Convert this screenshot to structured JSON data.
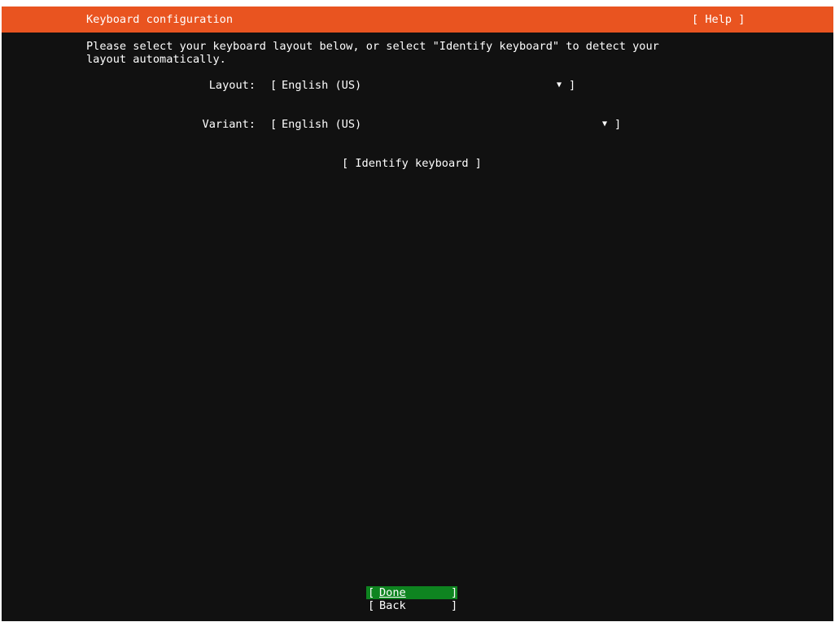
{
  "header": {
    "title": "Keyboard configuration",
    "help_label": "[ Help ]"
  },
  "intro": {
    "text": "Please select your keyboard layout below, or select \"Identify keyboard\" to detect your layout automatically."
  },
  "form": {
    "layout": {
      "label": "Layout:",
      "value": "English (US)"
    },
    "variant": {
      "label": "Variant:",
      "value": "English (US)"
    },
    "identify_label": "[ Identify keyboard ]"
  },
  "buttons": {
    "done": {
      "label": "Done"
    },
    "back": {
      "label": "Back"
    }
  },
  "symbols": {
    "open_bracket": "[",
    "close_bracket": "]",
    "dropdown_arrow": "▼"
  },
  "colors": {
    "accent": "#e95420",
    "background": "#111111",
    "focus_button": "#0e8420",
    "text": "#ffffff"
  }
}
